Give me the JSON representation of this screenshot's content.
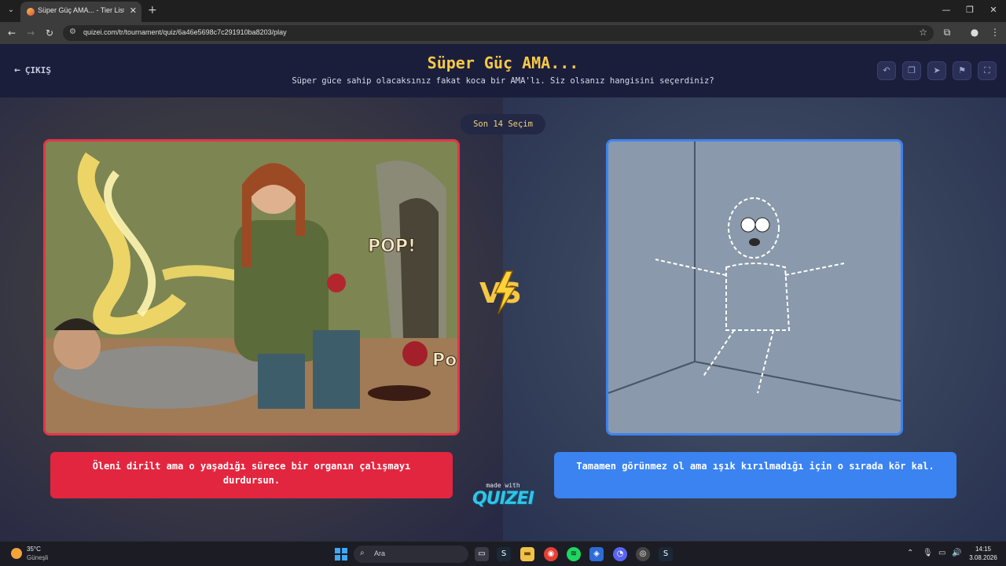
{
  "browser": {
    "tab_title": "Süper Güç AMA... - Tier List, Kö",
    "url": "quizei.com/tr/tournament/quiz/6a46e5698c7c291910ba8203/play"
  },
  "header": {
    "exit_label": "ÇIKIŞ",
    "title": "Süper Güç AMA...",
    "subtitle": "Süper güce sahip olacaksınız fakat koca bir AMA'lı. Siz olsanız hangisini seçerdiniz?"
  },
  "stage": {
    "badge": "Son 14 Seçim",
    "left_caption": "Öleni dirilt ama o yaşadığı sürece bir organın çalışmayı durdursun.",
    "right_caption": "Tamamen görünmez ol ama ışık kırılmadığı için o sırada kör kal.",
    "vs_text": "VS",
    "made_with": "made with",
    "brand": "QUIZEI"
  },
  "taskbar": {
    "temperature": "35°C",
    "weather": "Güneşli",
    "search_placeholder": "Ara",
    "time": "14:15",
    "date": "3.08.2026"
  },
  "colors": {
    "accent_yellow": "#f7c948",
    "left_red": "#e2263f",
    "right_blue": "#3a83f1"
  }
}
